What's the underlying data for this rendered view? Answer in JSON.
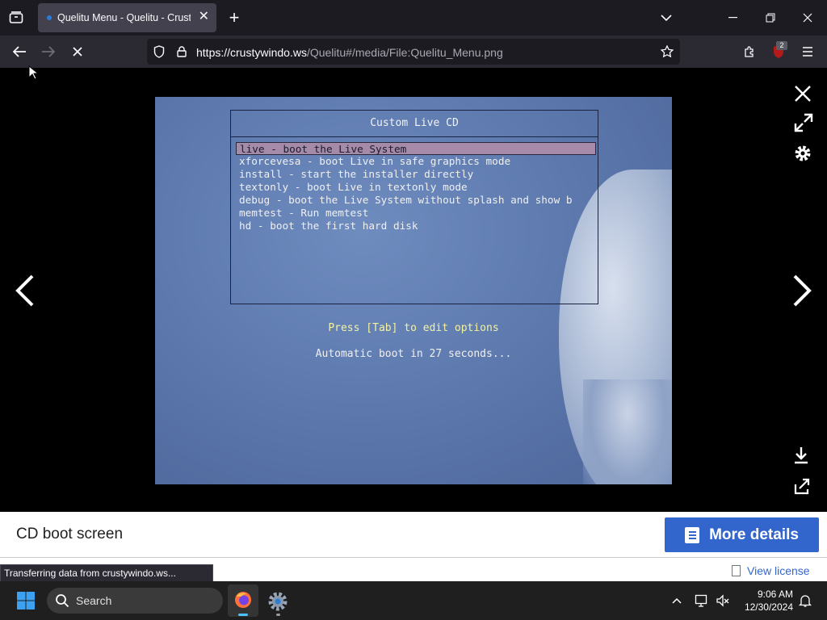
{
  "browser": {
    "tab_title": "Quelitu Menu - Quelitu - Crusty",
    "url_host": "https://crustywindo.ws",
    "url_path": "/Quelitu#/media/File:Quelitu_Menu.png",
    "extension_badge": "2",
    "status_text": "Transferring data from crustywindo.ws..."
  },
  "bootscreen": {
    "title": "Custom Live CD",
    "entries": [
      "live - boot the Live System",
      "xforcevesa - boot Live in safe graphics mode",
      "install - start the installer directly",
      "textonly - boot Live in textonly mode",
      "debug - boot the Live System without splash and show b",
      "memtest - Run memtest",
      "hd - boot the first hard disk"
    ],
    "selected_index": 0,
    "hint": "Press [Tab] to edit options",
    "countdown": "Automatic boot in 27 seconds..."
  },
  "details": {
    "caption": "CD boot screen",
    "more_details_label": "More details",
    "view_license_label": "View license"
  },
  "taskbar": {
    "search_label": "Search",
    "time": "9:06 AM",
    "date": "12/30/2024"
  },
  "colors": {
    "accent": "#3366cc",
    "chrome_bg": "#1c1b22",
    "menu_highlight": "#a58aaa",
    "hint_text": "#f4f2a0"
  }
}
